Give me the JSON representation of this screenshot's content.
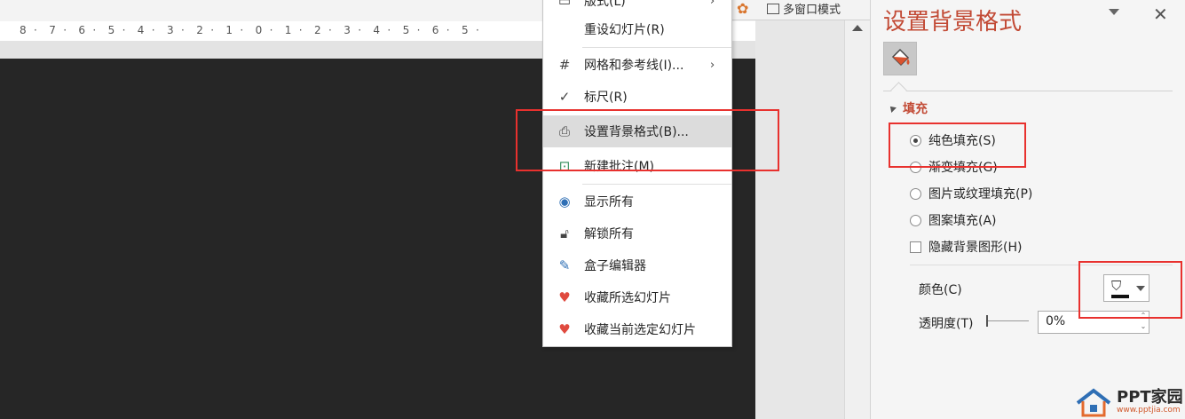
{
  "ruler": {
    "ticks": [
      "8",
      "7",
      "6",
      "5",
      "4",
      "3",
      "2",
      "1",
      "0",
      "1",
      "2",
      "3",
      "4",
      "5",
      "6",
      "5"
    ]
  },
  "toolbar": {
    "multi_window_label": "多窗口模式"
  },
  "context_menu": {
    "items": [
      {
        "label": "版式(L)",
        "icon": "layout-icon"
      },
      {
        "label": "重设幻灯片(R)",
        "icon": ""
      },
      {
        "label": "网格和参考线(I)...",
        "icon": "grid-icon",
        "submenu": true
      },
      {
        "label": "标尺(R)",
        "icon": "check-icon"
      },
      {
        "label": "设置背景格式(B)...",
        "icon": "format-background-icon",
        "highlighted": true
      },
      {
        "label": "新建批注(M)",
        "icon": "new-comment-icon"
      },
      {
        "label": "显示所有",
        "icon": "eye-icon"
      },
      {
        "label": "解锁所有",
        "icon": "unlock-icon"
      },
      {
        "label": "盒子编辑器",
        "icon": "edit-icon"
      },
      {
        "label": "收藏所选幻灯片",
        "icon": "heart-add-icon"
      },
      {
        "label": "收藏当前选定幻灯片",
        "icon": "heart-icon"
      }
    ]
  },
  "panel": {
    "title": "设置背景格式",
    "fill_section_title": "填充",
    "options": [
      {
        "label": "纯色填充(S)",
        "checked": true
      },
      {
        "label": "渐变填充(G)",
        "checked": false
      },
      {
        "label": "图片或纹理填充(P)",
        "checked": false
      },
      {
        "label": "图案填充(A)",
        "checked": false
      }
    ],
    "hide_bg_graphics": "隐藏背景图形(H)",
    "color_label": "颜色(C)",
    "transparency_label": "透明度(T)",
    "transparency_value": "0%"
  },
  "watermark": {
    "name": "PPT家园",
    "url": "www.pptjia.com"
  },
  "colors": {
    "accent": "#c24a35",
    "highlight_box": "#e8312e",
    "slide": "#262626"
  }
}
